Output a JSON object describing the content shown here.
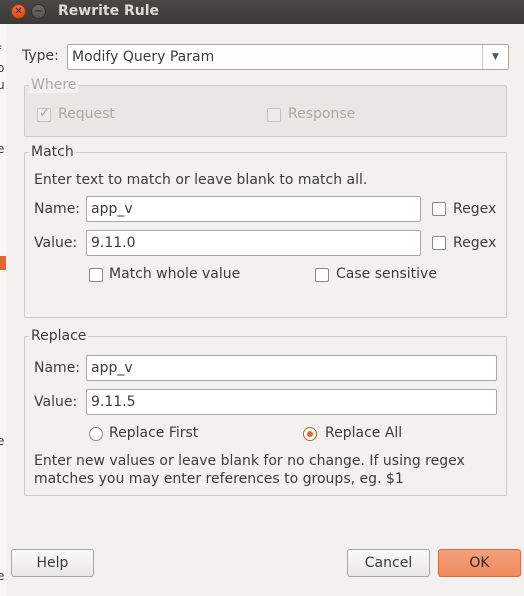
{
  "window": {
    "title": "Rewrite Rule"
  },
  "type": {
    "label": "Type:",
    "value": "Modify Query Param"
  },
  "where": {
    "title": "Where",
    "request_label": "Request",
    "response_label": "Response",
    "request_checked": true,
    "response_checked": false
  },
  "match": {
    "title": "Match",
    "hint": "Enter text to match or leave blank to match all.",
    "name_label": "Name:",
    "name_value": "app_v",
    "value_label": "Value:",
    "value_value": "9.11.0",
    "regex_label": "Regex",
    "whole_value_label": "Match whole value",
    "case_sensitive_label": "Case sensitive"
  },
  "replace": {
    "title": "Replace",
    "name_label": "Name:",
    "name_value": "app_v",
    "value_label": "Value:",
    "value_value": "9.11.5",
    "replace_first_label": "Replace First",
    "replace_all_label": "Replace All",
    "selected": "Replace All",
    "hint_line1": "Enter new values or leave blank for no change. If using regex",
    "hint_line2": "matches you may enter references to groups, eg. $1"
  },
  "buttons": {
    "help": "Help",
    "cancel": "Cancel",
    "ok": "OK"
  },
  "icons": {
    "close": "close-icon",
    "minimize": "minimize-icon",
    "dropdown": "chevron-down-icon"
  },
  "colors": {
    "accent": "#e0662c",
    "titlebar": "#3c3b37"
  }
}
